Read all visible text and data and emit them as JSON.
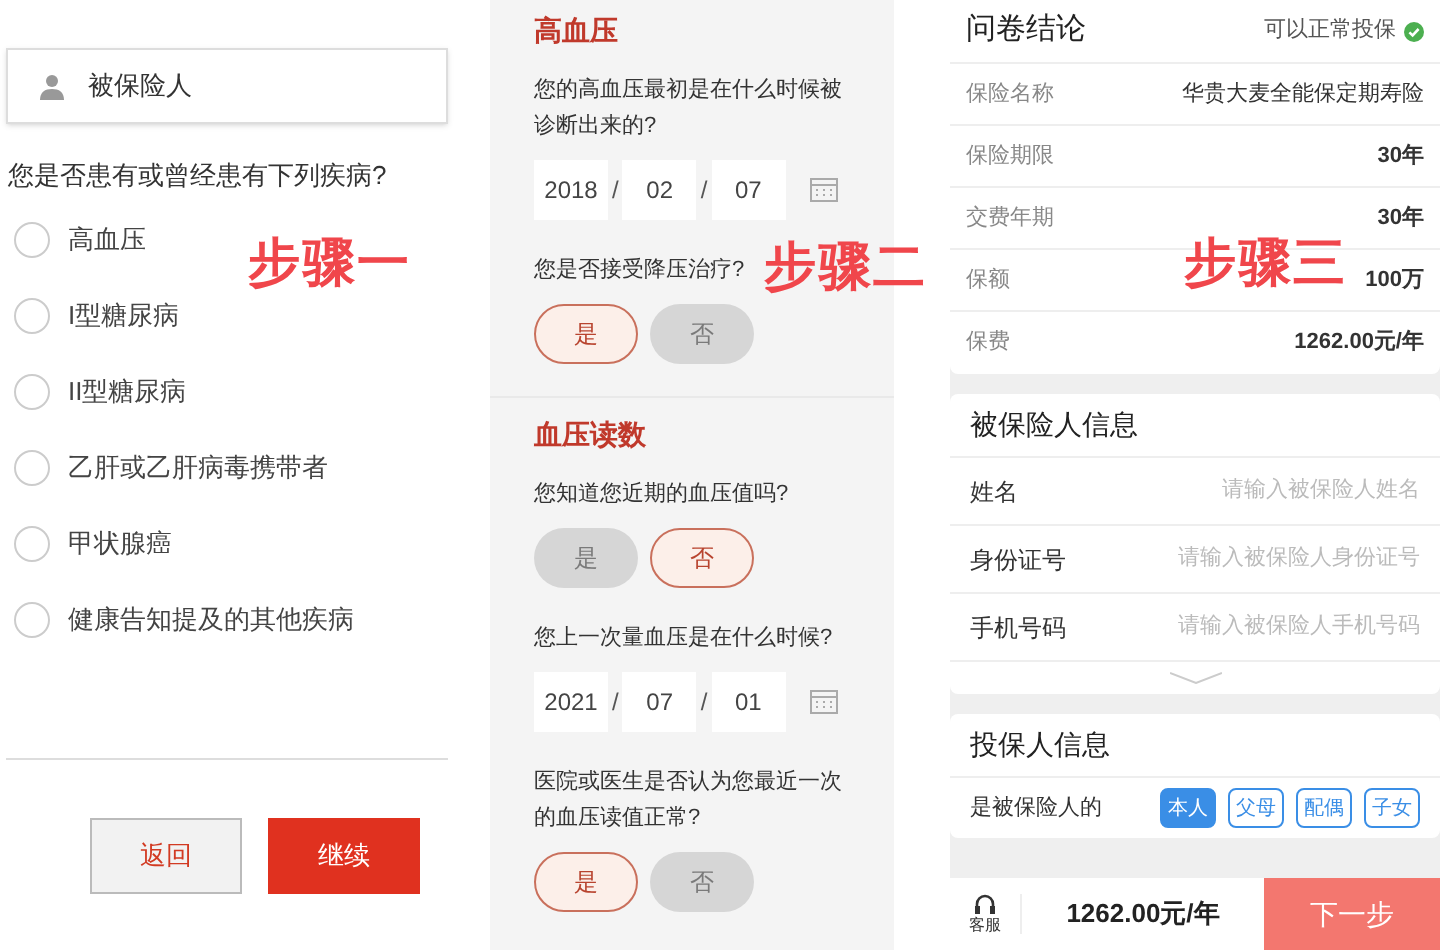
{
  "step_labels": [
    "步骤一",
    "步骤二",
    "步骤三"
  ],
  "step1": {
    "insured_field": "被保险人",
    "question": "您是否患有或曾经患有下列疾病?",
    "options": [
      {
        "label": "高血压",
        "checked": false
      },
      {
        "label": "I型糖尿病",
        "checked": false
      },
      {
        "label": "II型糖尿病",
        "checked": false
      },
      {
        "label": "乙肝或乙肝病毒携带者",
        "checked": false
      },
      {
        "label": "甲状腺癌",
        "checked": false
      },
      {
        "label": "健康告知提及的其他疾病",
        "checked": false
      }
    ],
    "back_button": "返回",
    "continue_button": "继续"
  },
  "step2": {
    "sections": [
      {
        "title": "高血压",
        "questions": [
          {
            "kind": "date",
            "text": "您的高血压最初是在什么时候被诊断出来的?",
            "date": [
              "2018",
              "02",
              "07"
            ]
          },
          {
            "kind": "choice",
            "text": "您是否接受降压治疗?",
            "choices": [
              {
                "label": "是",
                "selected": true
              },
              {
                "label": "否",
                "selected": false
              }
            ]
          }
        ]
      },
      {
        "title": "血压读数",
        "questions": [
          {
            "kind": "choice",
            "text": "您知道您近期的血压值吗?",
            "choices": [
              {
                "label": "是",
                "selected": false
              },
              {
                "label": "否",
                "selected": true
              }
            ]
          },
          {
            "kind": "date",
            "text": "您上一次量血压是在什么时候?",
            "date": [
              "2021",
              "07",
              "01"
            ]
          },
          {
            "kind": "choice",
            "text": "医院或医生是否认为您最近一次的血压读值正常?",
            "choices": [
              {
                "label": "是",
                "selected": true
              },
              {
                "label": "否",
                "selected": false
              }
            ]
          }
        ]
      }
    ],
    "date_separator": "/"
  },
  "step3": {
    "conclusion": {
      "title": "问卷结论",
      "status": "可以正常投保",
      "rows": [
        {
          "label": "保险名称",
          "value": "华贵大麦全能保定期寿险"
        },
        {
          "label": "保险期限",
          "value": "30年"
        },
        {
          "label": "交费年期",
          "value": "30年"
        },
        {
          "label": "保额",
          "value": "100万"
        },
        {
          "label": "保费",
          "value": "1262.00元/年"
        }
      ]
    },
    "insured": {
      "title": "被保险人信息",
      "fields": [
        {
          "label": "姓名",
          "placeholder": "请输入被保险人姓名"
        },
        {
          "label": "身份证号",
          "placeholder": "请输入被保险人身份证号"
        },
        {
          "label": "手机号码",
          "placeholder": "请输入被保险人手机号码"
        }
      ]
    },
    "policyholder": {
      "title": "投保人信息",
      "relation_label": "是被保险人的",
      "relations": [
        {
          "label": "本人",
          "selected": true
        },
        {
          "label": "父母",
          "selected": false
        },
        {
          "label": "配偶",
          "selected": false
        },
        {
          "label": "子女",
          "selected": false
        }
      ]
    },
    "bottom_bar": {
      "service": "客服",
      "price": "1262.00元/年",
      "next_button": "下一步"
    }
  }
}
